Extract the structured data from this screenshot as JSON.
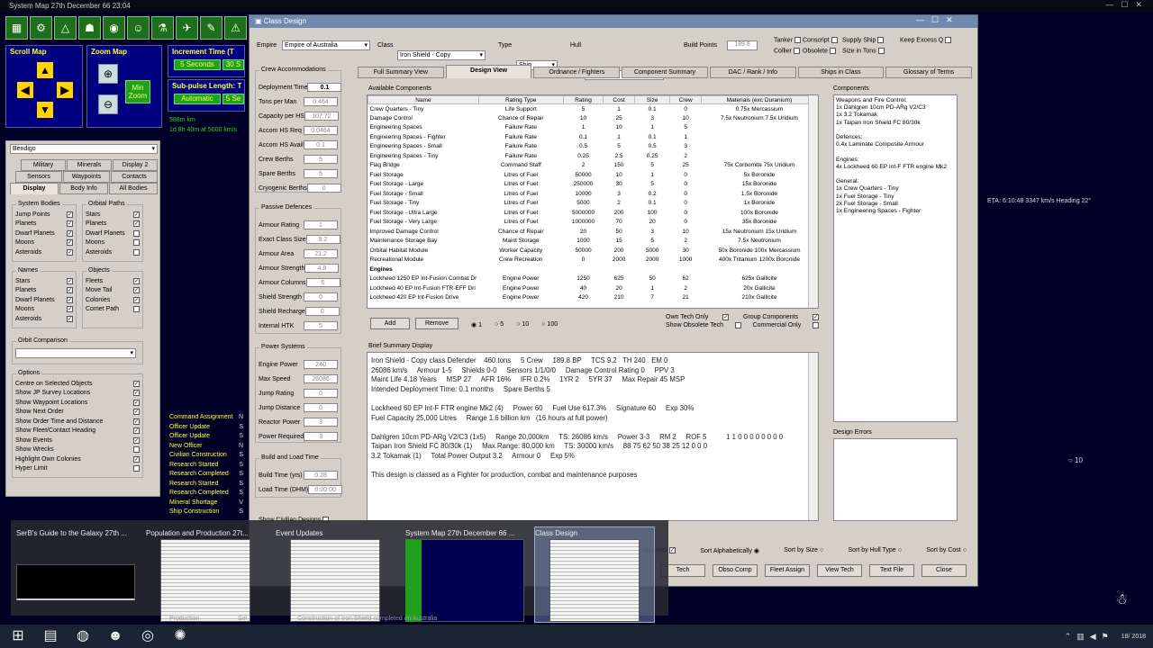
{
  "system_map": {
    "title": "System Map  27th December 66 23:04",
    "scroll_map": "Scroll Map",
    "zoom_map": "Zoom Map",
    "min_zoom": "Min Zoom",
    "increment_time": "Increment Time (T",
    "inc_buttons": [
      "5 Seconds",
      "30 S"
    ],
    "sub_pulse": "Sub-pulse Length: T",
    "sub_buttons": [
      "Automatic",
      "5 Se"
    ],
    "distance1": "588m km",
    "distance2": "1d 8h 40m at 5000 km/s",
    "system_select": "Bendigo",
    "tabs_row1": [
      "Military",
      "Minerals",
      "Display 2"
    ],
    "tabs_row2": [
      "Sensors",
      "Waypoints",
      "Contacts"
    ],
    "tabs_row3": [
      "Display",
      "Body Info",
      "All Bodies"
    ],
    "system_bodies_title": "System Bodies",
    "system_bodies": [
      {
        "label": "Jump Points",
        "checked": true
      },
      {
        "label": "Planets",
        "checked": true
      },
      {
        "label": "Dwarf Planets",
        "checked": true
      },
      {
        "label": "Moons",
        "checked": true
      },
      {
        "label": "Asteroids",
        "checked": true
      }
    ],
    "orbital_paths_title": "Orbital Paths",
    "orbital_paths": [
      {
        "label": "Stars",
        "checked": true
      },
      {
        "label": "Planets",
        "checked": true
      },
      {
        "label": "Dwarf Planets",
        "checked": false
      },
      {
        "label": "Moons",
        "checked": false
      },
      {
        "label": "Asteroids",
        "checked": false
      }
    ],
    "names_title": "Names",
    "names": [
      {
        "label": "Stars",
        "checked": true
      },
      {
        "label": "Planets",
        "checked": true
      },
      {
        "label": "Dwarf Planets",
        "checked": true
      },
      {
        "label": "Moons",
        "checked": true
      },
      {
        "label": "Asteroids",
        "checked": true
      }
    ],
    "objects_title": "Objects",
    "objects": [
      {
        "label": "Fleets",
        "checked": true
      },
      {
        "label": "Move Tail",
        "checked": true
      },
      {
        "label": "Colonies",
        "checked": true
      },
      {
        "label": "Comet Path",
        "checked": false
      }
    ],
    "orbit_comparison": "Orbit Comparison",
    "options_title": "Options",
    "options": [
      {
        "label": "Centre on Selected Objects",
        "checked": true
      },
      {
        "label": "Show JP Survey Locations",
        "checked": true
      },
      {
        "label": "Show Waypoint Locations",
        "checked": true
      },
      {
        "label": "Show Next Order",
        "checked": true
      },
      {
        "label": "Show Order Time and Distance",
        "checked": true
      },
      {
        "label": "Show Fleet/Contact Heading",
        "checked": true
      },
      {
        "label": "Show Events",
        "checked": true
      },
      {
        "label": "Show Wrecks",
        "checked": false
      },
      {
        "label": "Highlight Own Colonies",
        "checked": true
      },
      {
        "label": "Hyper Limit",
        "checked": false
      }
    ],
    "events": [
      "Command Assignment",
      "Officer Update",
      "Officer Update",
      "New Officer",
      "Civilian Construction",
      "Research Started",
      "Research Completed",
      "Research Started",
      "Research Completed",
      "Mineral Shortage",
      "Ship Construction"
    ],
    "event_suffix": [
      "N",
      "S",
      "S",
      "N",
      "S",
      "S",
      "S",
      "S",
      "S",
      "V",
      "S"
    ],
    "map_text_eta": "ETA: 6:10:48  3347 km/s  Heading 22°",
    "map_text_10": "10",
    "bottom_production": "Production",
    "bottom_sol": "Sol",
    "bottom_completed": "Construction of Iron Shield completed on Australia"
  },
  "class_design": {
    "title": "Class Design",
    "empire_label": "Empire",
    "empire_value": "Empire of Australia",
    "class_label": "Class",
    "class_value": "Iron Shield - Copy",
    "type_label": "Type",
    "type_value": "Ship",
    "hull_label": "Hull",
    "hull_value": "Defender",
    "build_points_label": "Build Points",
    "build_points_value": "189.8",
    "flags": [
      {
        "label": "Tanker",
        "checked": false
      },
      {
        "label": "Conscript",
        "checked": false
      },
      {
        "label": "Supply Ship",
        "checked": false
      },
      {
        "label": "Keep Excess Q",
        "checked": false
      },
      {
        "label": "Collier",
        "checked": false
      },
      {
        "label": "Obsolete",
        "checked": false
      },
      {
        "label": "Size in Tons",
        "checked": false
      }
    ],
    "tabs": [
      "Full Summary View",
      "Design View",
      "Ordnance / Fighters",
      "Component Summary",
      "DAC / Rank / Info",
      "Ships in Class",
      "Glossary of Terms"
    ],
    "active_tab": "Design View",
    "crew_title": "Crew Accommodations",
    "crew_fields": [
      {
        "label": "Deployment Time",
        "value": "0.1"
      },
      {
        "label": "Tons per Man",
        "value": "0.464"
      },
      {
        "label": "Capacity per HS",
        "value": "107.72"
      },
      {
        "label": "Accom HS Req",
        "value": "0.0464"
      },
      {
        "label": "Accom HS Avail",
        "value": "0.1"
      },
      {
        "label": "Crew Berths",
        "value": "5"
      },
      {
        "label": "Spare Berths",
        "value": "5"
      },
      {
        "label": "Cryogenic Berths",
        "value": "0"
      }
    ],
    "passive_title": "Passive Defences",
    "passive_fields": [
      {
        "label": "Armour Rating",
        "value": "1"
      },
      {
        "label": "Exact Class Size",
        "value": "9.2"
      },
      {
        "label": "Armour Area",
        "value": "21.2"
      },
      {
        "label": "Armour Strength",
        "value": "4.8"
      },
      {
        "label": "Armour Columns",
        "value": "5"
      },
      {
        "label": "Shield Strength",
        "value": "0"
      },
      {
        "label": "Shield Recharge",
        "value": "0"
      },
      {
        "label": "Internal HTK",
        "value": "5"
      }
    ],
    "power_title": "Power Systems",
    "power_fields": [
      {
        "label": "Engine Power",
        "value": "240"
      },
      {
        "label": "Max Speed",
        "value": "26086"
      },
      {
        "label": "Jump Rating",
        "value": "0"
      },
      {
        "label": "Jump Distance",
        "value": "0"
      },
      {
        "label": "Reactor Power",
        "value": "3"
      },
      {
        "label": "Power Required",
        "value": "3"
      }
    ],
    "build_title": "Build and Load Time",
    "build_fields": [
      {
        "label": "Build Time (yrs)",
        "value": "0.28"
      },
      {
        "label": "Load Time (DHM)",
        "value": "0:00:00"
      }
    ],
    "show_civilian": "Show Civilian Designs",
    "available_title": "Available Components",
    "columns": [
      "Name",
      "Rating Type",
      "Rating",
      "Cost",
      "Size",
      "Crew",
      "Materials (exc Duranium)"
    ],
    "rows": [
      [
        "Crew Quarters - Tiny",
        "Life Support",
        "5",
        "1",
        "0.1",
        "0",
        "0.75x Mercassium"
      ],
      [
        "Damage Control",
        "Chance of Repair",
        "10",
        "25",
        "3",
        "10",
        "7.5x Neutronium  7.5x Uridium"
      ],
      [
        "Engineering Spaces",
        "Failure Rate",
        "1",
        "10",
        "1",
        "5",
        ""
      ],
      [
        "Engineering Spaces - Fighter",
        "Failure Rate",
        "0.1",
        "1",
        "0.1",
        "1",
        ""
      ],
      [
        "Engineering Spaces - Small",
        "Failure Rate",
        "0.5",
        "5",
        "0.5",
        "3",
        ""
      ],
      [
        "Engineering Spaces - Tiny",
        "Failure Rate",
        "0.25",
        "2.5",
        "0.25",
        "2",
        ""
      ],
      [
        "Flag Bridge",
        "Command Staff",
        "2",
        "150",
        "5",
        "25",
        "75x Corbomite  75x Uridium"
      ],
      [
        "Fuel Storage",
        "Litres of Fuel",
        "50000",
        "10",
        "1",
        "0",
        "5x Boronide"
      ],
      [
        "Fuel Storage - Large",
        "Litres of Fuel",
        "250000",
        "30",
        "5",
        "0",
        "15x Boronide"
      ],
      [
        "Fuel Storage - Small",
        "Litres of Fuel",
        "10000",
        "3",
        "0.2",
        "0",
        "1.5x Boronide"
      ],
      [
        "Fuel Storage - Tiny",
        "Litres of Fuel",
        "5000",
        "2",
        "0.1",
        "0",
        "1x Boronide"
      ],
      [
        "Fuel Storage - Ultra Large",
        "Litres of Fuel",
        "5000000",
        "200",
        "100",
        "0",
        "100x Boronide"
      ],
      [
        "Fuel Storage - Very Large",
        "Litres of Fuel",
        "1000000",
        "70",
        "20",
        "0",
        "35x Boronide"
      ],
      [
        "Improved Damage Control",
        "Chance of Repair",
        "20",
        "50",
        "3",
        "10",
        "15x Neutronium  15x Uridium"
      ],
      [
        "Maintenance Storage Bay",
        "Maint Storage",
        "1000",
        "15",
        "5",
        "2",
        "7.5x Neutronium"
      ],
      [
        "Orbital Habitat Module",
        "Worker Capacity",
        "50000",
        "200",
        "5000",
        "30",
        "50x Boronide  100x Mercassium"
      ],
      [
        "Recreational Module",
        "Crew Recreation",
        "0",
        "2000",
        "2000",
        "1000",
        "400x Tritanium  1200x Boronide"
      ],
      [
        "Engines",
        "",
        "",
        "",
        "",
        "",
        ""
      ],
      [
        "Lockheed 1250 EP Int-Fusion Combat Dr",
        "Engine Power",
        "1250",
        "625",
        "50",
        "62",
        "625x Gallicite"
      ],
      [
        "Lockheed 40 EP Int-Fusion FTR-EFF Dri",
        "Engine Power",
        "40",
        "20",
        "1",
        "2",
        "20x Gallicite"
      ],
      [
        "Lockheed 420 EP Int-Fusion Drive",
        "Engine Power",
        "420",
        "210",
        "7",
        "21",
        "210x Gallicite"
      ]
    ],
    "add_button": "Add",
    "remove_button": "Remove",
    "qty_options": [
      "1",
      "5",
      "10",
      "100"
    ],
    "own_tech_only": "Own Tech Only",
    "group_components": "Group Components",
    "show_obsolete_tech": "Show Obsolete Tech",
    "commercial_only": "Commercial Only",
    "components_title": "Components",
    "components_text": "Weapons and Fire Control:\n1x Dahlgren 10cm PD-ARg V2/C3\n1x 3.2 Tokamak\n1x Taipan Iron Shield FC 80/30k\n\nDefences:\n0.4x Laminate Composite Armour\n\nEngines:\n4x Lockheed 60 EP Int-F FTR engine Mk2\n\nGeneral:\n1x Crew Quarters - Tiny\n1x Fuel Storage - Tiny\n2x Fuel Storage - Small\n1x Engineering Spaces - Fighter",
    "brief_title": "Brief Summary Display",
    "brief_text": "Iron Shield - Copy class Defender    460 tons     5 Crew     189.8 BP     TCS 9.2   TH 240   EM 0\n26086 km/s     Armour 1-5     Shields 0-0     Sensors 1/1/0/0     Damage Control Rating 0     PPV 3\nMaint Life 4.18 Years     MSP 27     AFR 16%     IFR 0.2%     1YR 2     5YR 37     Max Repair 45 MSP\nIntended Deployment Time: 0.1 months     Spare Berths 5\n\nLockheed 60 EP Int-F FTR engine Mk2 (4)     Power 60     Fuel Use 617.3%     Signature 60     Exp 30%\nFuel Capacity 25,000 Litres     Range 1.6 billion km   (16 hours at full power)\n\nDahlgren 10cm PD-ARg V2/C3 (1x5)     Range 20,000km     TS: 26086 km/s     Power 3-3     RM 2     ROF 5          1 1 0 0 0 0 0 0 0 0\nTaipan Iron Shield FC 80/30k (1)     Max Range: 80,000 km     TS: 30000 km/s     88 75 62 50 38 25 12 0 0 0\n3.2 Tokamak (1)     Total Power Output 3.2     Armour 0     Exp 5%\n\nThis design is classed as a Fighter for production, combat and maintenance purposes",
    "design_errors_title": "Design Errors",
    "bottom_checks": [
      {
        "label": "Obsolete",
        "checked": true
      },
      {
        "label": "Sort Alphabetically",
        "checked": true
      },
      {
        "label": "Sort by Size",
        "checked": false
      },
      {
        "label": "Sort by Hull Type",
        "checked": false
      },
      {
        "label": "Sort by Cost",
        "checked": false
      }
    ],
    "bottom_buttons": [
      "Tech",
      "Obso Comp",
      "Fleet Assign",
      "View Tech",
      "Text File",
      "Close"
    ]
  },
  "alt_tab": {
    "items": [
      {
        "label": "SerB's Guide to the Galaxy  27th ...",
        "thumb": "dark-window"
      },
      {
        "label": "Population and Production  27t...",
        "thumb": "grey-window"
      },
      {
        "label": "Event Updates",
        "thumb": "grey-window"
      },
      {
        "label": "System Map  27th December 66 ...",
        "thumb": "map-window"
      },
      {
        "label": "Class Design",
        "thumb": "grey-window"
      }
    ],
    "selected": "Class Design"
  },
  "taskbar": {
    "apps": [
      "windows-start-icon",
      "file-explorer-icon",
      "firefox-icon",
      "discord-icon",
      "obs-icon",
      "aurora-icon"
    ],
    "clock_lines": [
      "",
      "18/     2018"
    ],
    "tray_icons": [
      "chevron-up-icon",
      "network-icon",
      "speaker-icon",
      "flag-icon"
    ]
  },
  "colors": {
    "desktop": "#000026",
    "map_green": "#2bd12b",
    "map_yellow": "#ffff40",
    "window_bg": "#d4d0c8",
    "title_bar": "#6f8ab0"
  }
}
